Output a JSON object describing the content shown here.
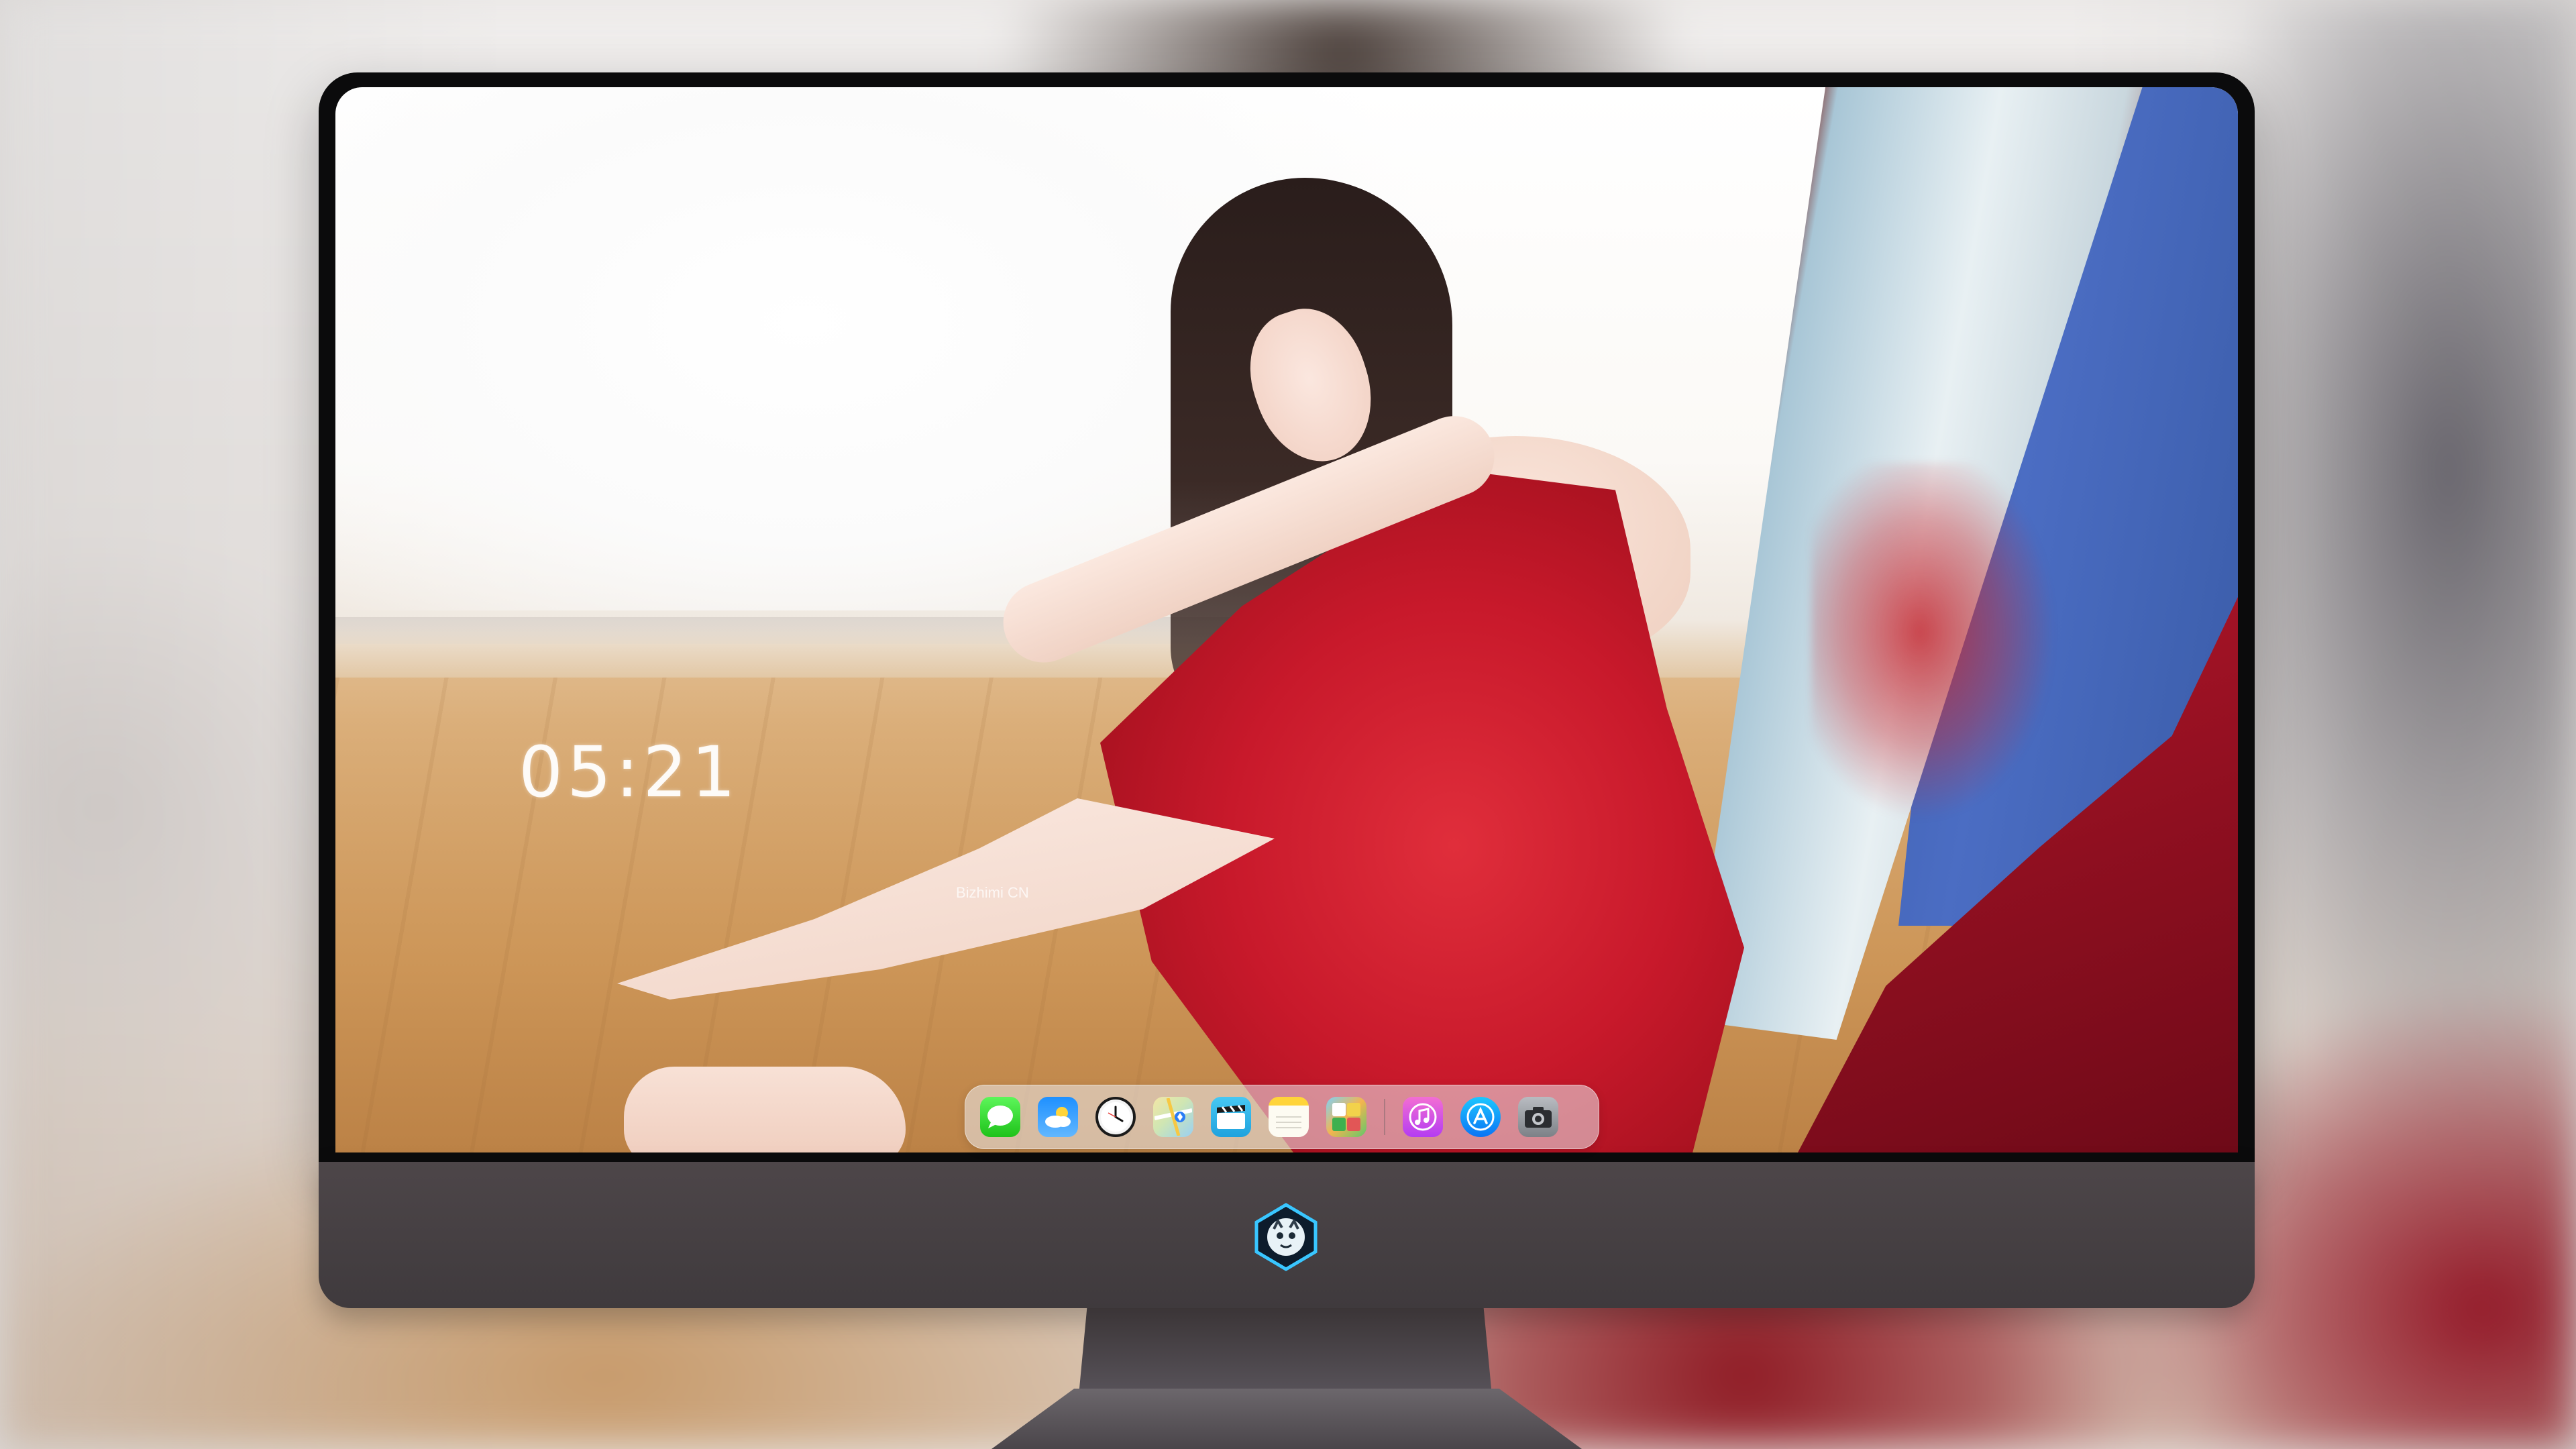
{
  "desktop": {
    "clock_time": "05:21",
    "watermark": "Bizhimi CN"
  },
  "dock": {
    "apps": [
      {
        "name": "Messages",
        "icon": "messages-icon"
      },
      {
        "name": "Weather",
        "icon": "weather-icon"
      },
      {
        "name": "Clock",
        "icon": "clock-icon"
      },
      {
        "name": "Maps",
        "icon": "maps-icon"
      },
      {
        "name": "Clips",
        "icon": "clips-icon"
      },
      {
        "name": "Notes",
        "icon": "notes-icon"
      },
      {
        "name": "Photos",
        "icon": "photos-icon"
      }
    ],
    "pinned": [
      {
        "name": "Music",
        "icon": "music-icon"
      },
      {
        "name": "App Store",
        "icon": "app-store-icon"
      },
      {
        "name": "Camera",
        "icon": "camera-icon"
      }
    ]
  },
  "monitor": {
    "logo": "dragon-logo-icon",
    "accent_color": "#3f3a3d"
  }
}
